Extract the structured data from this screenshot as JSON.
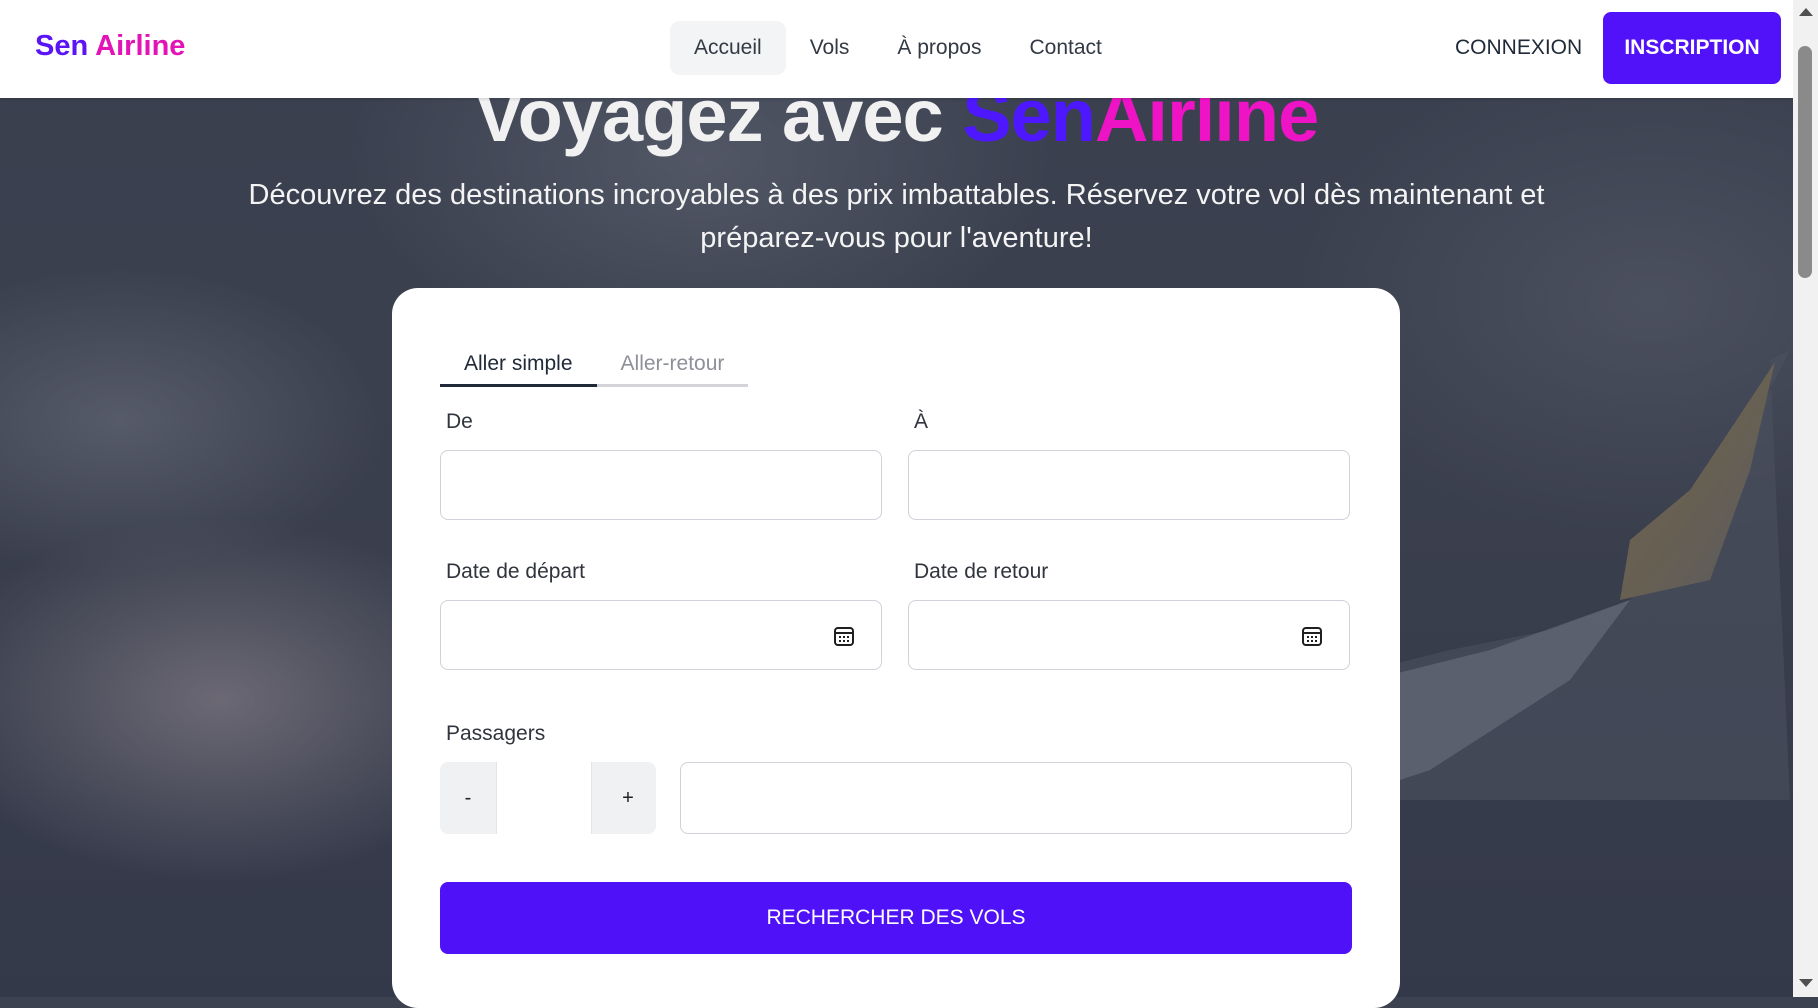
{
  "navbar": {
    "logo_part1": "Sen",
    "logo_part2": "Airline",
    "links": [
      {
        "label": "Accueil",
        "active": true
      },
      {
        "label": "Vols",
        "active": false
      },
      {
        "label": "À propos",
        "active": false
      },
      {
        "label": "Contact",
        "active": false
      }
    ],
    "login_label": "CONNEXION",
    "signup_label": "INSCRIPTION"
  },
  "hero": {
    "title_prefix": "Voyagez avec ",
    "title_brand1": "Sen",
    "title_brand2": "Airline",
    "subtitle": "Découvrez des destinations incroyables à des prix imbattables. Réservez votre vol dès maintenant et préparez-vous pour l'aventure!"
  },
  "search": {
    "tabs": [
      {
        "label": "Aller simple",
        "active": true
      },
      {
        "label": "Aller-retour",
        "active": false
      }
    ],
    "from_label": "De",
    "from_value": "",
    "to_label": "À",
    "to_value": "",
    "departure_label": "Date de départ",
    "departure_value": "",
    "return_label": "Date de retour",
    "return_value": "",
    "passengers_label": "Passagers",
    "passengers_value": "",
    "minus_label": "-",
    "plus_label": "+",
    "class_value": "",
    "submit_label": "RECHERCHER DES VOLS",
    "calendar_icon": "calendar-icon"
  },
  "colors": {
    "brand_purple": "#5112fa",
    "brand_pink": "#ee13c5"
  }
}
